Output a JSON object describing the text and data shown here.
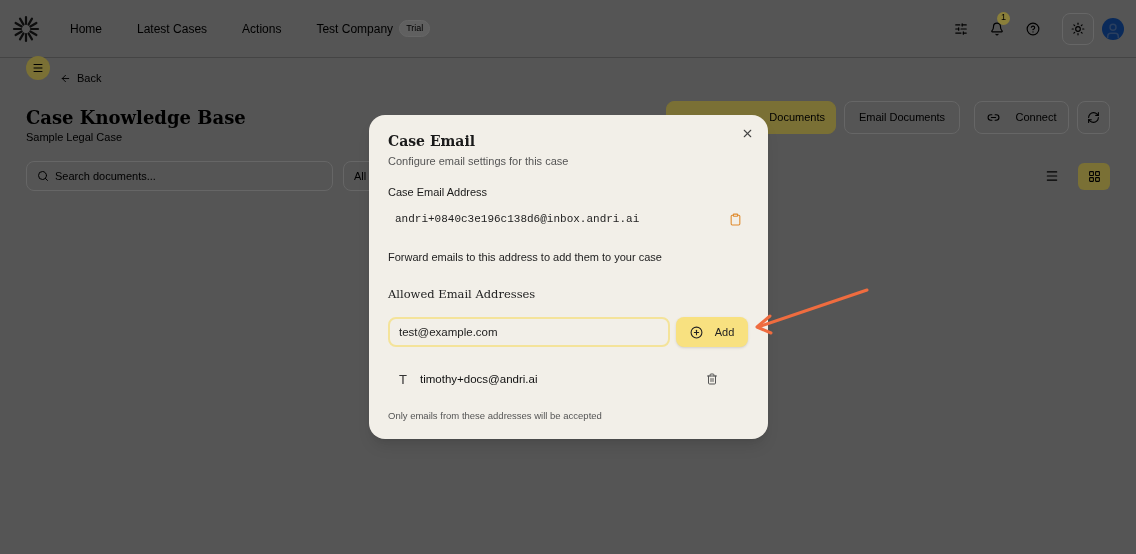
{
  "nav": {
    "items": [
      {
        "label": "Home"
      },
      {
        "label": "Latest Cases"
      },
      {
        "label": "Actions"
      },
      {
        "label": "Test Company",
        "badge": "Trial"
      }
    ],
    "notification_count": "1"
  },
  "page": {
    "back": "Back",
    "title": "Case Knowledge Base",
    "subtitle": "Sample Legal Case",
    "actions": [
      {
        "label": "Documents",
        "kind": "primary"
      },
      {
        "label": "Email Documents",
        "kind": "outline"
      },
      {
        "label": "Connect",
        "kind": "link"
      },
      {
        "kind": "refresh"
      }
    ],
    "search": {
      "placeholder": "Search documents..."
    },
    "filter": "All",
    "views": [
      {
        "kind": "list",
        "selected": false
      },
      {
        "kind": "grid",
        "selected": true
      }
    ]
  },
  "dialog": {
    "title": "Case Email",
    "description": "Configure email settings for this case",
    "address_label": "Case Email Address",
    "address": "andri+0840c3e196c138d6@inbox.andri.ai",
    "hint": "Forward emails to this address to add them to your case",
    "allowed_title": "Allowed Email Addresses",
    "input_value": "test@example.com",
    "add_label": "Add",
    "allowed": [
      {
        "initial": "T",
        "email": "timothy+docs@andri.ai"
      }
    ],
    "footnote": "Only emails from these addresses will be accepted"
  }
}
